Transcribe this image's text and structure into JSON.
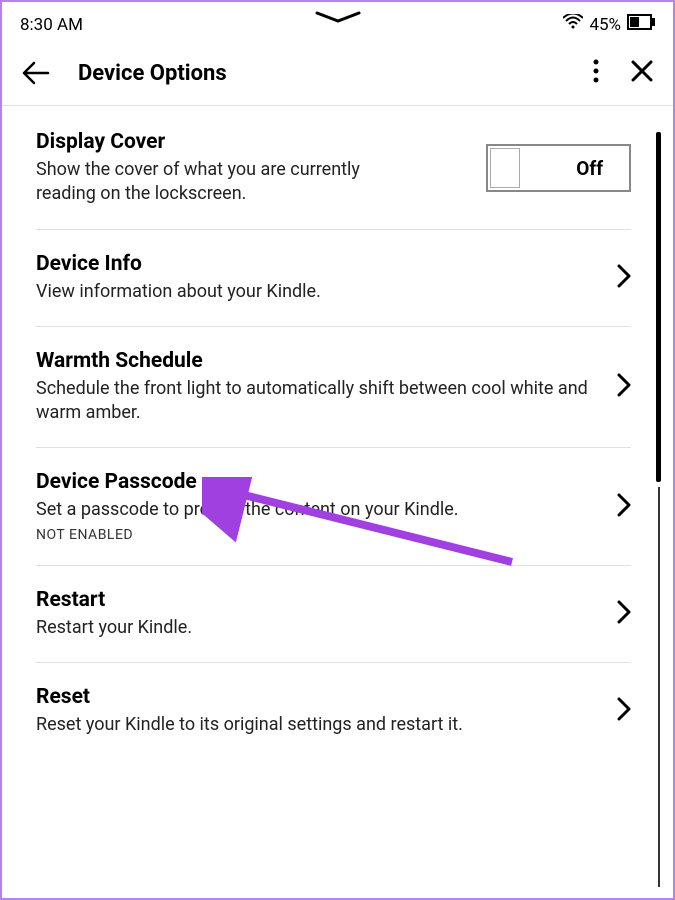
{
  "status": {
    "time": "8:30 AM",
    "battery_percent": "45%"
  },
  "header": {
    "title": "Device Options"
  },
  "items": {
    "display_cover": {
      "title": "Display Cover",
      "desc": "Show the cover of what you are currently reading on the lockscreen.",
      "toggle_label": "Off"
    },
    "device_info": {
      "title": "Device Info",
      "desc": "View information about your Kindle."
    },
    "warmth": {
      "title": "Warmth Schedule",
      "desc": "Schedule the front light to automatically shift between cool white and warm amber."
    },
    "passcode": {
      "title": "Device Passcode",
      "desc": "Set a passcode to protect the content on your Kindle.",
      "status": "NOT ENABLED"
    },
    "restart": {
      "title": "Restart",
      "desc": "Restart your Kindle."
    },
    "reset": {
      "title": "Reset",
      "desc": "Reset your Kindle to its original settings and restart it."
    }
  }
}
